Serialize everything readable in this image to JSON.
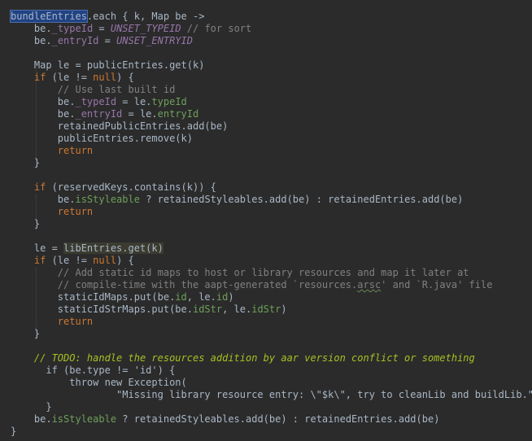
{
  "editor": {
    "lines": [
      [
        {
          "t": "bundleEntries",
          "c": "plain hl-box"
        },
        {
          "t": ".each { k, Map be ->",
          "c": "plain"
        }
      ],
      [
        {
          "t": "    ",
          "c": "plain"
        },
        {
          "t": "be.",
          "c": "plain"
        },
        {
          "t": "_typeId",
          "c": "prop"
        },
        {
          "t": " = ",
          "c": "plain"
        },
        {
          "t": "UNSET_TYPEID",
          "c": "const"
        },
        {
          "t": " // for sort",
          "c": "comment"
        }
      ],
      [
        {
          "t": "    ",
          "c": "plain"
        },
        {
          "t": "be.",
          "c": "plain"
        },
        {
          "t": "_entryId",
          "c": "prop"
        },
        {
          "t": " = ",
          "c": "plain"
        },
        {
          "t": "UNSET_ENTRYID",
          "c": "const"
        }
      ],
      [
        {
          "t": "",
          "c": "plain"
        }
      ],
      [
        {
          "t": "    Map le = publicEntries.get(k)",
          "c": "plain"
        }
      ],
      [
        {
          "t": "    ",
          "c": "plain"
        },
        {
          "t": "if",
          "c": "kw"
        },
        {
          "t": " (le != ",
          "c": "plain"
        },
        {
          "t": "null",
          "c": "kw"
        },
        {
          "t": ") {",
          "c": "plain"
        }
      ],
      [
        {
          "t": "        ",
          "c": "plain"
        },
        {
          "t": "// Use last built id",
          "c": "comment"
        }
      ],
      [
        {
          "t": "        be.",
          "c": "plain"
        },
        {
          "t": "_typeId",
          "c": "prop"
        },
        {
          "t": " = le.",
          "c": "plain"
        },
        {
          "t": "typeId",
          "c": "fieldg"
        }
      ],
      [
        {
          "t": "        be.",
          "c": "plain"
        },
        {
          "t": "_entryId",
          "c": "prop"
        },
        {
          "t": " = le.",
          "c": "plain"
        },
        {
          "t": "entryId",
          "c": "fieldg"
        }
      ],
      [
        {
          "t": "        retainedPublicEntries.add(be)",
          "c": "plain"
        }
      ],
      [
        {
          "t": "        publicEntries.remove(k)",
          "c": "plain"
        }
      ],
      [
        {
          "t": "        ",
          "c": "plain"
        },
        {
          "t": "return",
          "c": "kw"
        }
      ],
      [
        {
          "t": "    }",
          "c": "plain"
        }
      ],
      [
        {
          "t": "",
          "c": "plain"
        }
      ],
      [
        {
          "t": "    ",
          "c": "plain"
        },
        {
          "t": "if",
          "c": "kw"
        },
        {
          "t": " (reservedKeys.contains(k)) {",
          "c": "plain"
        }
      ],
      [
        {
          "t": "        be.",
          "c": "plain"
        },
        {
          "t": "isStyleable",
          "c": "fieldg"
        },
        {
          "t": " ? retainedStyleables.add(be) : retainedEntries.add(be)",
          "c": "plain"
        }
      ],
      [
        {
          "t": "        ",
          "c": "plain"
        },
        {
          "t": "return",
          "c": "kw"
        }
      ],
      [
        {
          "t": "    }",
          "c": "plain"
        }
      ],
      [
        {
          "t": "",
          "c": "plain"
        }
      ],
      [
        {
          "t": "    le = ",
          "c": "plain"
        },
        {
          "t": "libEntries.get(k)",
          "c": "plain hl-usage"
        }
      ],
      [
        {
          "t": "    ",
          "c": "plain"
        },
        {
          "t": "if",
          "c": "kw"
        },
        {
          "t": " (le != ",
          "c": "plain"
        },
        {
          "t": "null",
          "c": "kw"
        },
        {
          "t": ") {",
          "c": "plain"
        }
      ],
      [
        {
          "t": "        ",
          "c": "plain"
        },
        {
          "t": "// Add static id maps to host or library resources and map it later at",
          "c": "comment"
        }
      ],
      [
        {
          "t": "        ",
          "c": "plain"
        },
        {
          "t": "// compile-time with the aapt-generated `resources.",
          "c": "comment"
        },
        {
          "t": "arsc",
          "c": "comment squiggle"
        },
        {
          "t": "' and `R.java' file",
          "c": "comment"
        }
      ],
      [
        {
          "t": "        staticIdMaps.put(be.",
          "c": "plain"
        },
        {
          "t": "id",
          "c": "fieldg"
        },
        {
          "t": ", le.",
          "c": "plain"
        },
        {
          "t": "id",
          "c": "fieldg"
        },
        {
          "t": ")",
          "c": "plain"
        }
      ],
      [
        {
          "t": "        staticIdStrMaps.put(be.",
          "c": "plain"
        },
        {
          "t": "idStr",
          "c": "fieldg"
        },
        {
          "t": ", le.",
          "c": "plain"
        },
        {
          "t": "idStr",
          "c": "fieldg"
        },
        {
          "t": ")",
          "c": "plain"
        }
      ],
      [
        {
          "t": "        ",
          "c": "plain"
        },
        {
          "t": "return",
          "c": "kw"
        }
      ],
      [
        {
          "t": "    }",
          "c": "plain"
        }
      ],
      [
        {
          "t": "",
          "c": "plain"
        }
      ],
      [
        {
          "t": "    ",
          "c": "plain"
        },
        {
          "t": "// TODO: handle the resources addition by aar version conflict or something",
          "c": "todo"
        }
      ],
      [
        {
          "t": "      if (be.type != 'id') {",
          "c": "plain"
        }
      ],
      [
        {
          "t": "          throw new Exception(",
          "c": "plain"
        }
      ],
      [
        {
          "t": "                  \"Missing library resource entry: \\\"$k\\\", try to cleanLib and buildLib.\")",
          "c": "plain"
        }
      ],
      [
        {
          "t": "      }",
          "c": "plain"
        }
      ],
      [
        {
          "t": "    be.",
          "c": "plain"
        },
        {
          "t": "isStyleable",
          "c": "fieldg"
        },
        {
          "t": " ? retainedStyleables.add(be) : retainedEntries.add(be)",
          "c": "plain"
        }
      ],
      [
        {
          "t": "}",
          "c": "plain"
        }
      ]
    ]
  }
}
